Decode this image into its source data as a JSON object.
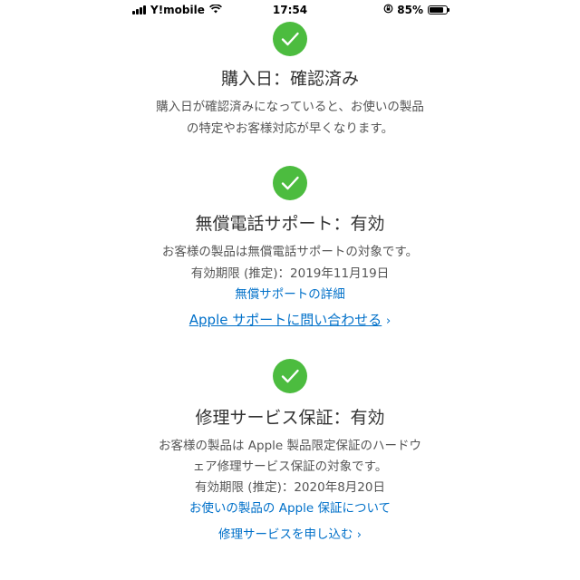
{
  "status_bar": {
    "carrier": "Y!mobile",
    "time": "17:54",
    "battery_percent": "85%",
    "battery_level": 0.85
  },
  "sections": [
    {
      "title": "購入日：確認済み",
      "desc_lines": [
        "購入日が確認済みになっていると、お使いの製品",
        "の特定やお客様対応が早くなります。"
      ]
    },
    {
      "title": "無償電話サポート：有効",
      "desc_lines": [
        "お客様の製品は無償電話サポートの対象です。",
        "有効期限 (推定)：2019年11月19日"
      ],
      "link": "無償サポートの詳細",
      "action": "Apple サポートに問い合わせる"
    },
    {
      "title": "修理サービス保証：有効",
      "desc_lines": [
        "お客様の製品は Apple 製品限定保証のハードウ",
        "ェア修理サービス保証の対象です。",
        "有効期限 (推定)：2020年8月20日"
      ],
      "link": "お使いの製品の Apple 保証について",
      "action": "修理サービスを申し込む"
    }
  ],
  "icons": {
    "check": "checkmark-circle-icon",
    "chevron": "chevron-right-icon",
    "check_color": "#4cbc3f",
    "link_color": "#0070c9"
  }
}
